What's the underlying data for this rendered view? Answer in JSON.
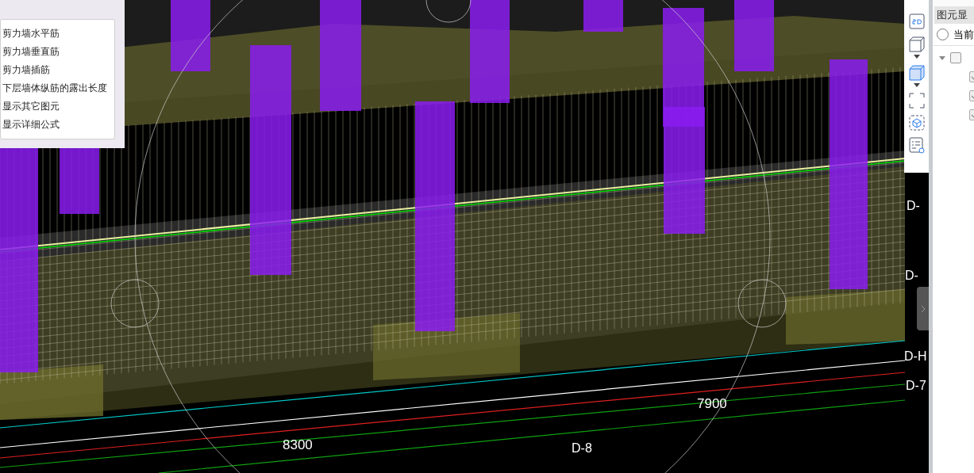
{
  "view_menu": {
    "items": [
      "剪力墙水平筋",
      "剪力墙垂直筋",
      "剪力墙插筋",
      "下层墙体纵筋的露出长度",
      "显示其它图元",
      "显示详细公式"
    ]
  },
  "axis_labels": [
    {
      "text": "D-",
      "kind": "axis"
    },
    {
      "text": "D-",
      "kind": "axis"
    },
    {
      "text": "D-H",
      "kind": "axis"
    },
    {
      "text": "D-7",
      "kind": "axis"
    },
    {
      "text": "D-8",
      "kind": "axis"
    },
    {
      "text": "7900",
      "kind": "dimension"
    },
    {
      "text": "8300",
      "kind": "dimension"
    }
  ],
  "toolbar": [
    {
      "kind": "flat",
      "selected": false
    },
    {
      "kind": "cube",
      "selected": false
    },
    {
      "kind": "cube",
      "selected": true
    },
    {
      "kind": "frame",
      "selected": false
    },
    {
      "kind": "box",
      "selected": false
    },
    {
      "kind": "list",
      "selected": false
    }
  ],
  "side_panel": {
    "tab": "图元显",
    "radio": {
      "label": "当前",
      "selected": false
    },
    "tree": {
      "checked": false,
      "expanded": true,
      "children": [
        {
          "checked": true
        },
        {
          "checked": true
        },
        {
          "checked": true
        }
      ]
    }
  }
}
